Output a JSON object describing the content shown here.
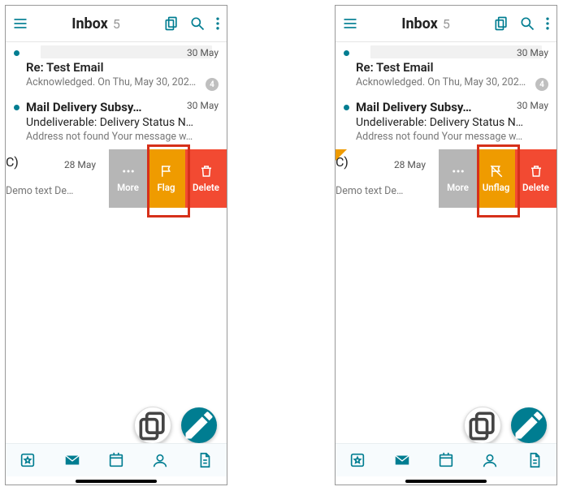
{
  "header": {
    "title": "Inbox",
    "count": "5"
  },
  "dates": {
    "d1": "30 May",
    "d2": "30 May",
    "d3": "28 May"
  },
  "msg1": {
    "sender": "Re: Test Email",
    "preview": "Acknowledged. On Thu, May 30, 202…",
    "badge": "4"
  },
  "msg2": {
    "sender": "Mail Delivery Subsy…",
    "subject": "Undeliverable: Delivery Status N…",
    "preview": "Address not found Your message w…"
  },
  "msg3": {
    "sender_cut": "C)",
    "preview_cut": "Demo text De…"
  },
  "actions": {
    "more": "More",
    "flag": "Flag",
    "unflag": "Unflag",
    "delete": "Delete"
  }
}
